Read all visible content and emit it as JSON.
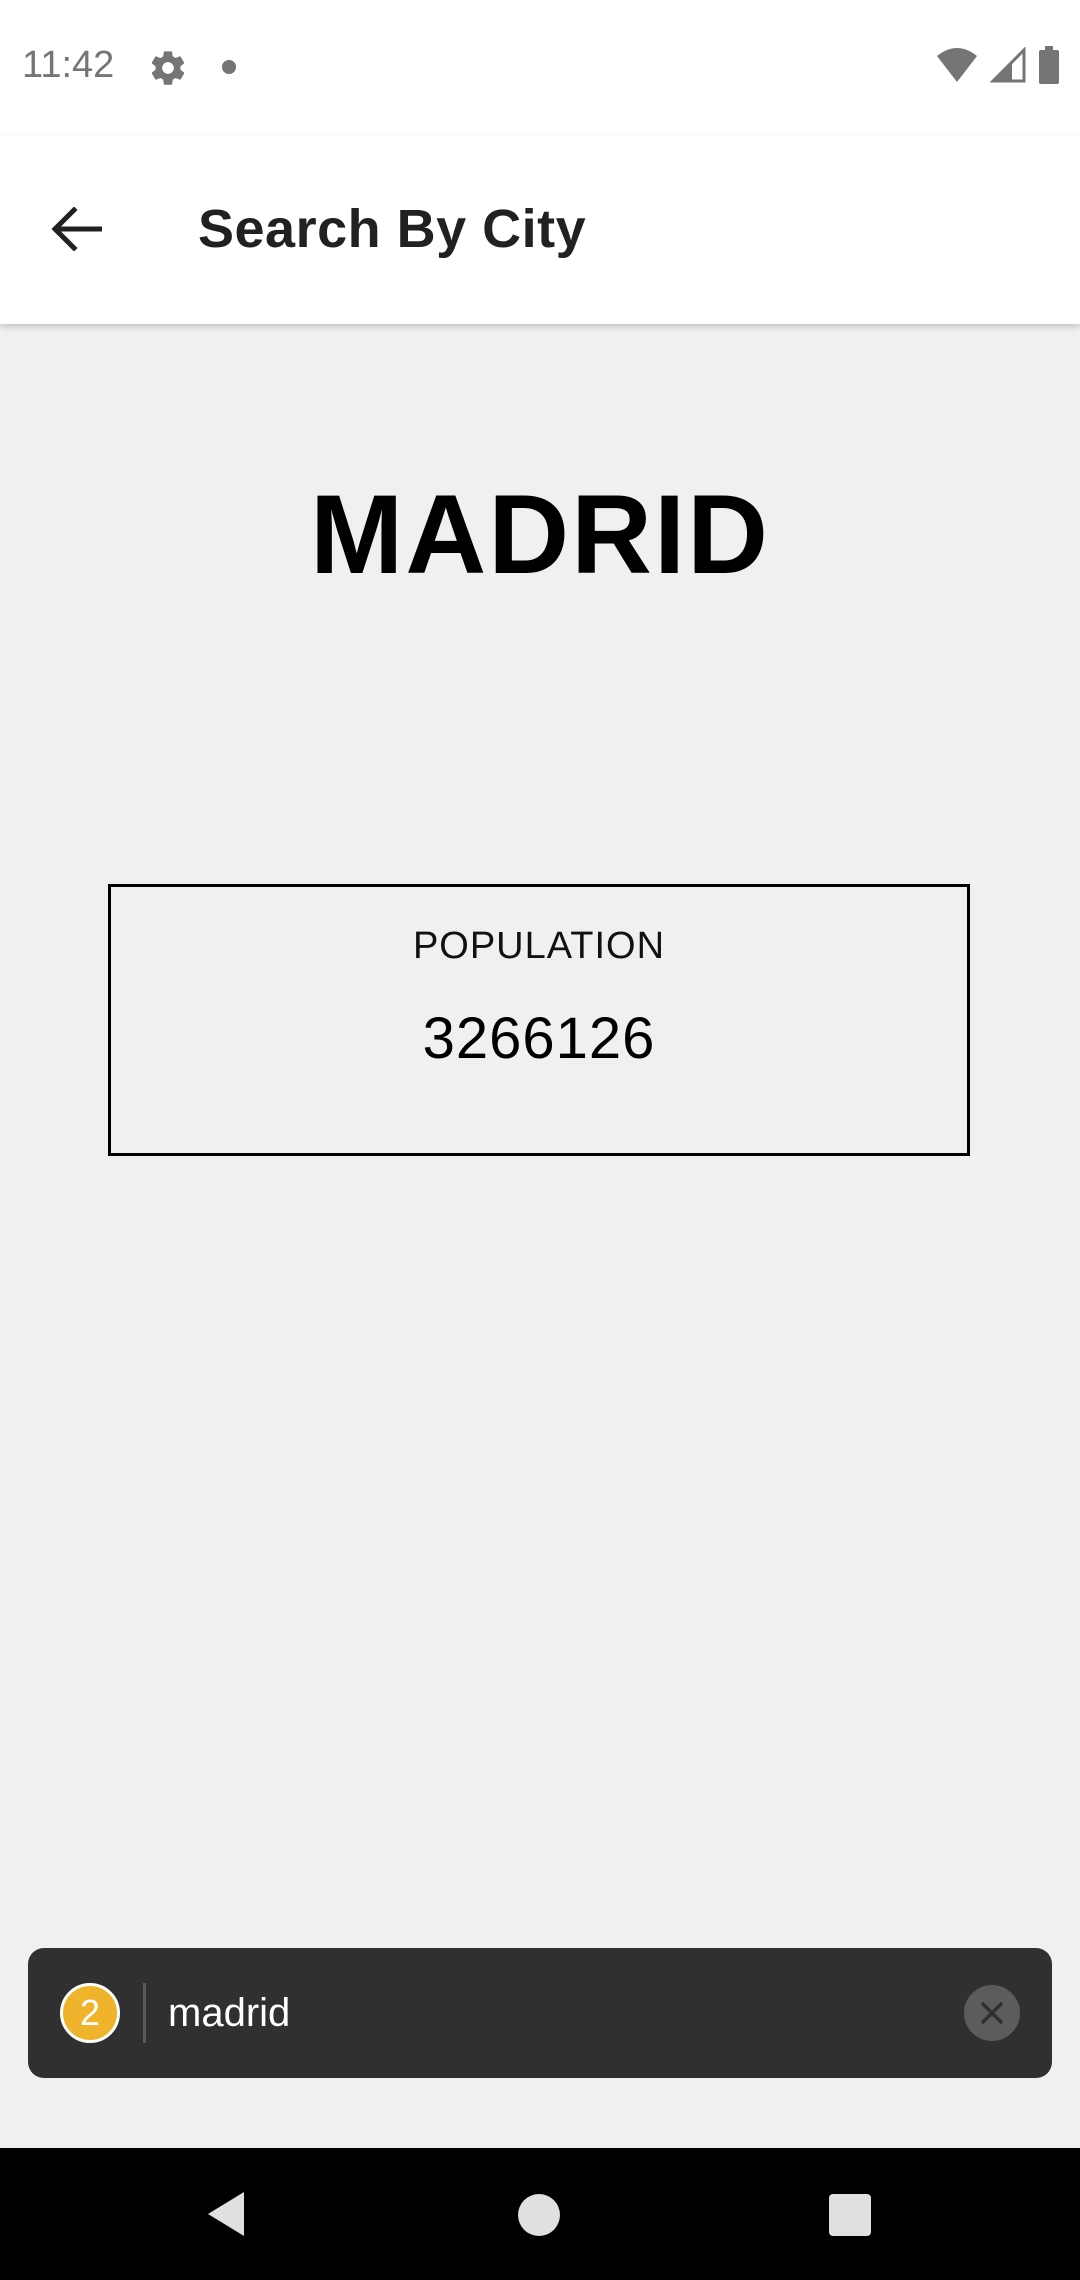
{
  "status_bar": {
    "time": "11:42",
    "icons": [
      "gear-icon",
      "notification-dot-icon",
      "wifi-icon",
      "cell-signal-icon",
      "battery-icon"
    ]
  },
  "app_bar": {
    "title": "Search By City",
    "back_icon": "arrow-left-icon"
  },
  "city": {
    "name": "MADRID"
  },
  "population": {
    "label": "POPULATION",
    "value": "3266126"
  },
  "search_bubble": {
    "badge_count": "2",
    "query": "madrid",
    "clear_icon": "close-icon",
    "badge_color": "#f0b42c",
    "background_color": "#303030"
  },
  "nav_bar": {
    "icons": [
      "nav-back-icon",
      "nav-home-icon",
      "nav-recents-icon"
    ]
  }
}
